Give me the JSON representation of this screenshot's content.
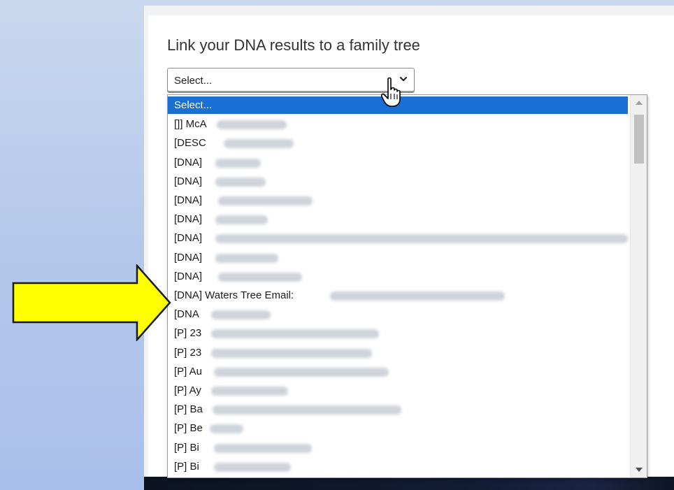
{
  "heading": "Link your DNA results to a family tree",
  "select": {
    "value": "Select..."
  },
  "dropdown": {
    "options": [
      {
        "label": "Select...",
        "selected": true
      },
      {
        "label": "[]] McA"
      },
      {
        "label": "[DESC"
      },
      {
        "label": "[DNA]"
      },
      {
        "label": "[DNA]"
      },
      {
        "label": "[DNA]"
      },
      {
        "label": "[DNA]"
      },
      {
        "label": "[DNA]"
      },
      {
        "label": "[DNA]"
      },
      {
        "label": "[DNA]"
      },
      {
        "label": "[DNA] Waters Tree Email:"
      },
      {
        "label": "[DNA"
      },
      {
        "label": "[P] 23"
      },
      {
        "label": "[P] 23"
      },
      {
        "label": "[P] Au"
      },
      {
        "label": "[P] Ay"
      },
      {
        "label": "[P] Ba"
      },
      {
        "label": "[P] Be"
      },
      {
        "label": "[P] Bi"
      },
      {
        "label": "[P] Bi"
      }
    ]
  },
  "colors": {
    "accent": "#1a6fd6",
    "arrow_fill": "#ffff00",
    "background": "#b4c8ea"
  },
  "icons": {
    "select_chevron": "chevron-down-icon",
    "cursor": "hand-pointer-icon",
    "annotation": "right-arrow-icon",
    "scroll_up": "triangle-up-icon",
    "scroll_down": "triangle-down-icon"
  }
}
